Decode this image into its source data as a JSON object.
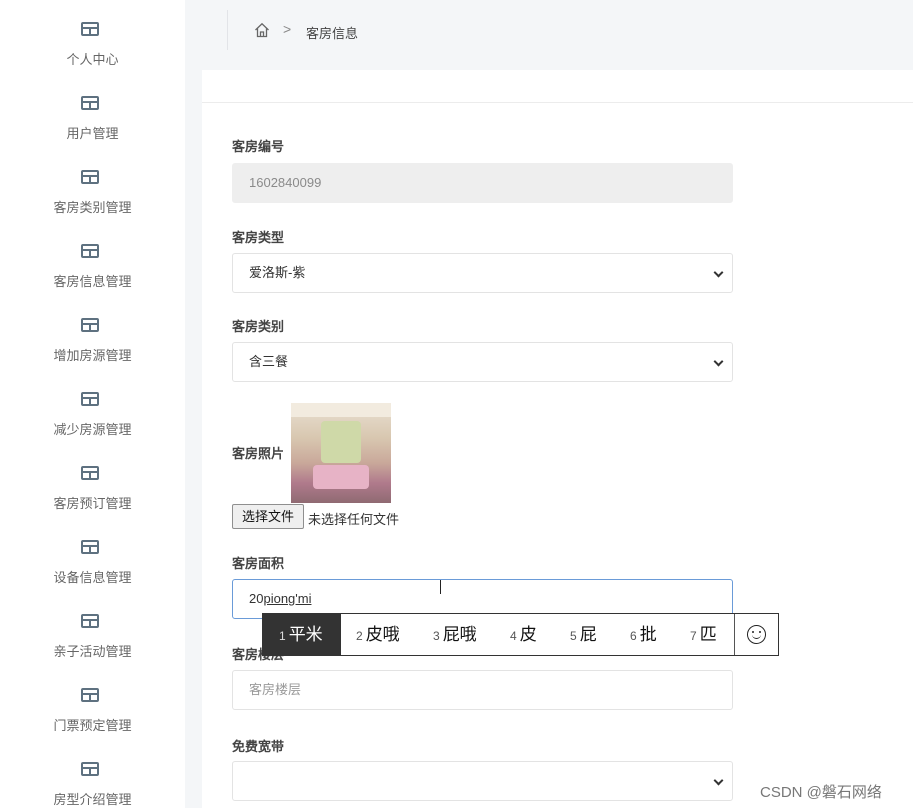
{
  "sidebar": {
    "items": [
      {
        "label": "个人中心",
        "icon": "table-icon"
      },
      {
        "label": "用户管理",
        "icon": "table-icon"
      },
      {
        "label": "客房类别管理",
        "icon": "table-icon"
      },
      {
        "label": "客房信息管理",
        "icon": "table-icon"
      },
      {
        "label": "增加房源管理",
        "icon": "table-icon"
      },
      {
        "label": "减少房源管理",
        "icon": "table-icon"
      },
      {
        "label": "客房预订管理",
        "icon": "table-icon"
      },
      {
        "label": "设备信息管理",
        "icon": "table-icon"
      },
      {
        "label": "亲子活动管理",
        "icon": "table-icon"
      },
      {
        "label": "门票预定管理",
        "icon": "table-icon"
      },
      {
        "label": "房型介绍管理",
        "icon": "table-icon"
      }
    ]
  },
  "breadcrumb": {
    "home_icon": "home-icon",
    "separator": ">",
    "current": "客房信息"
  },
  "form": {
    "room_no": {
      "label": "客房编号",
      "value": "1602840099"
    },
    "room_type": {
      "label": "客房类型",
      "value": "爱洛斯-紫"
    },
    "room_category": {
      "label": "客房类别",
      "value": "含三餐"
    },
    "room_photo": {
      "label": "客房照片",
      "choose_label": "选择文件",
      "no_file": "未选择任何文件"
    },
    "room_area": {
      "label": "客房面积",
      "value_prefix": "20",
      "value_composing": "piong'mi"
    },
    "room_floor": {
      "label": "客房楼层",
      "placeholder": "客房楼层"
    },
    "free_broadband": {
      "label": "免费宽带",
      "value": ""
    }
  },
  "ime": {
    "candidates": [
      {
        "num": "1",
        "text": "平米"
      },
      {
        "num": "2",
        "text": "皮哦"
      },
      {
        "num": "3",
        "text": "屁哦"
      },
      {
        "num": "4",
        "text": "皮"
      },
      {
        "num": "5",
        "text": "屁"
      },
      {
        "num": "6",
        "text": "批"
      },
      {
        "num": "7",
        "text": "匹"
      }
    ],
    "emoji_icon": "smiley-icon"
  },
  "watermark": "CSDN @磐石网络"
}
